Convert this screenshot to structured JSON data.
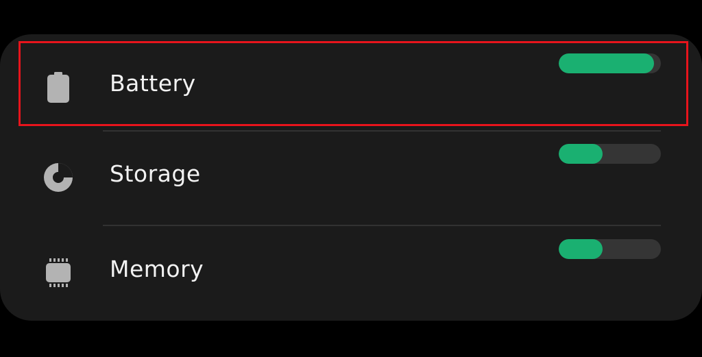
{
  "items": [
    {
      "label": "Battery",
      "icon": "battery-icon",
      "level": 0.93
    },
    {
      "label": "Storage",
      "icon": "storage-pie-icon",
      "level": 0.43
    },
    {
      "label": "Memory",
      "icon": "memory-chip-icon",
      "level": 0.43
    }
  ],
  "colors": {
    "background": "#000000",
    "card": "#1b1b1b",
    "bar_fill": "#1ab071",
    "bar_track": "#353535",
    "highlight": "#e8141c",
    "text": "#f2f2f2",
    "icon": "#b3b3b3"
  }
}
